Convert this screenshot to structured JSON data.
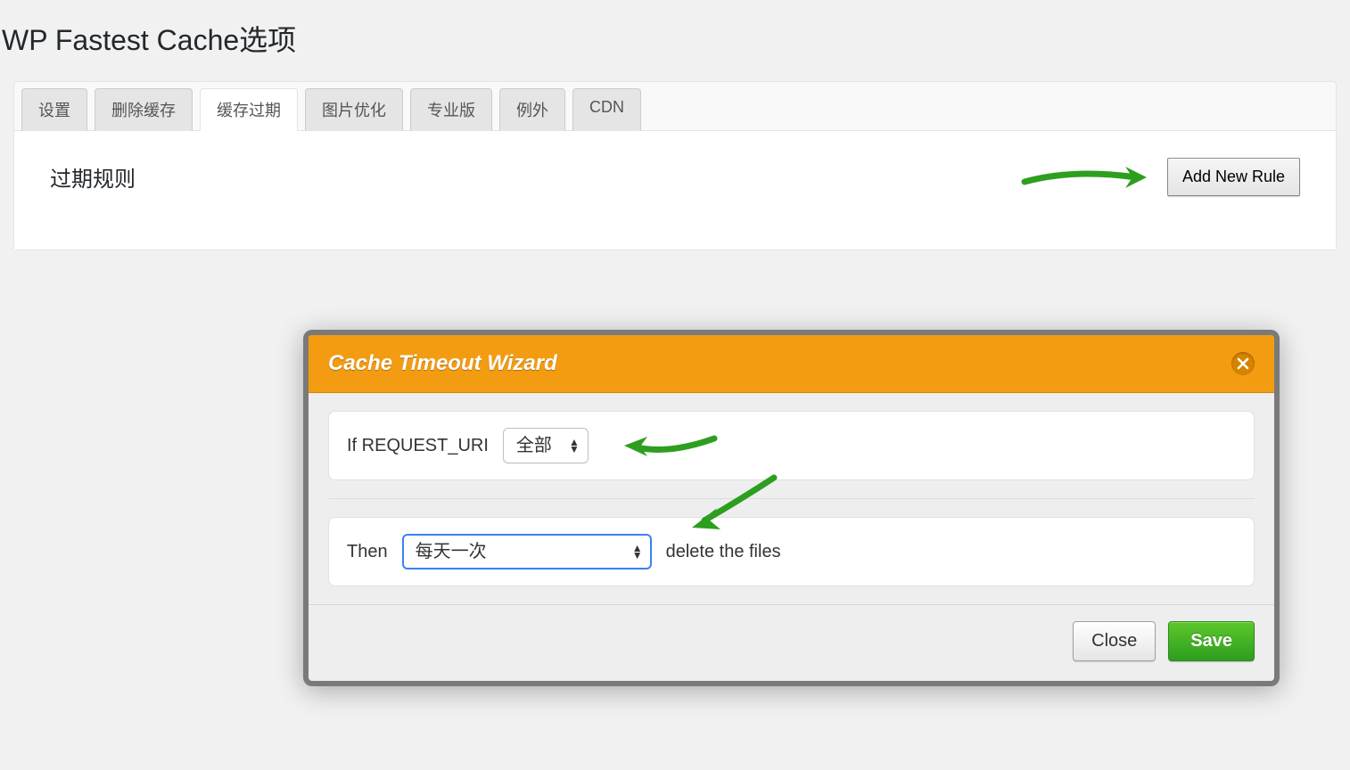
{
  "page": {
    "title": "WP Fastest Cache选项"
  },
  "tabs": [
    {
      "label": "设置"
    },
    {
      "label": "删除缓存"
    },
    {
      "label": "缓存过期",
      "active": true
    },
    {
      "label": "图片优化"
    },
    {
      "label": "专业版"
    },
    {
      "label": "例外"
    },
    {
      "label": "CDN"
    }
  ],
  "content": {
    "heading": "过期规则",
    "add_rule_button": "Add New Rule"
  },
  "dialog": {
    "title": "Cache Timeout Wizard",
    "row1": {
      "label": "If REQUEST_URI",
      "select_value": "全部"
    },
    "row2": {
      "label": "Then",
      "select_value": "每天一次",
      "suffix": "delete the files"
    },
    "buttons": {
      "close": "Close",
      "save": "Save"
    }
  }
}
